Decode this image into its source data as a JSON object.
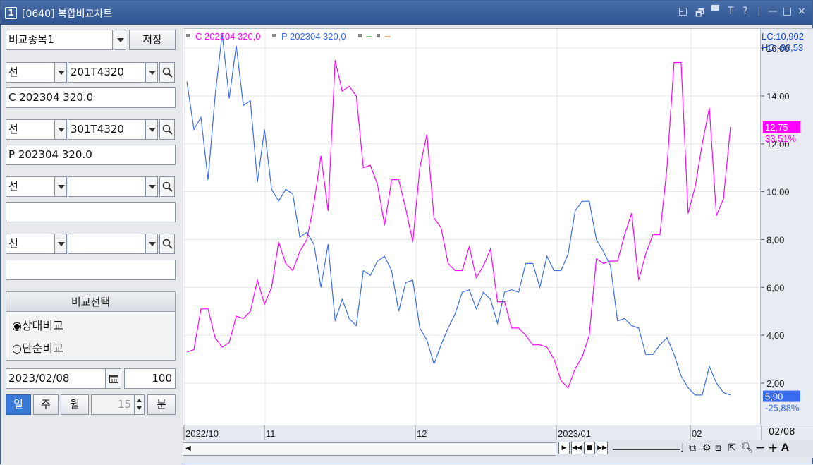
{
  "window": {
    "number": "1",
    "title": "[0640] 복합비교차트",
    "controls": [
      "◱",
      "🗗",
      "▀",
      "T",
      "?",
      "|",
      "—",
      "□",
      "×"
    ]
  },
  "panel": {
    "preset": "비교종목1",
    "save_label": "저장",
    "rows": [
      {
        "type": "선",
        "code": "201T4320",
        "name": "C 202304 320.0"
      },
      {
        "type": "선",
        "code": "301T4320",
        "name": "P 202304 320.0"
      },
      {
        "type": "선",
        "code": "",
        "name": ""
      },
      {
        "type": "선",
        "code": "",
        "name": ""
      }
    ],
    "compare_header": "비교선택",
    "relative": "◉상대비교",
    "simple": "○단순비교",
    "date": "2023/02/08",
    "count": "100",
    "periods": [
      "일",
      "주",
      "월"
    ],
    "minute_value": "15",
    "minute_label": "분"
  },
  "chart": {
    "legend": [
      {
        "label": "C 202304 320,0",
        "color": "#ff00ff"
      },
      {
        "label": "P 202304 320,0",
        "color": "#3a6cf0"
      }
    ],
    "legend_extra": [
      "−",
      "−"
    ],
    "top_right": [
      "LC:10,902",
      "HC:-88,53"
    ],
    "y_ticks": [
      "16,00",
      "14,00",
      "12,00",
      "10,00",
      "8,00",
      "6,00",
      "4,00",
      "2,00"
    ],
    "c_badge": {
      "value": "12,75",
      "pct": "33,51%",
      "color": "#ff00ff"
    },
    "p_badge": {
      "value": "5,90",
      "pct": "-25,88%",
      "color": "#3a6cf0"
    },
    "x_labels": [
      "2022/10",
      "11",
      "12",
      "2023/01",
      "02"
    ],
    "x_last": "02/08"
  },
  "chart_data": {
    "type": "line",
    "ylim": [
      0.2,
      16.8
    ],
    "series": [
      {
        "name": "C 202304 320,0",
        "color": "#ff00ff",
        "values": [
          3.3,
          3.4,
          5.1,
          5.1,
          3.9,
          3.5,
          3.7,
          4.8,
          4.7,
          5.0,
          6.3,
          5.3,
          6.0,
          7.9,
          7.0,
          6.7,
          7.5,
          8.0,
          9.5,
          11.5,
          9.2,
          15.5,
          14.2,
          14.4,
          14.0,
          11.0,
          11.1,
          10.3,
          8.6,
          10.5,
          10.5,
          9.3,
          7.9,
          11.0,
          12.4,
          8.9,
          8.5,
          7.0,
          6.7,
          6.7,
          7.7,
          6.4,
          6.9,
          7.6,
          5.4,
          5.4,
          4.3,
          4.3,
          4.0,
          3.6,
          3.6,
          3.5,
          3.0,
          2.1,
          1.8,
          2.6,
          3.1,
          4.0,
          7.2,
          7.0,
          7.1,
          7.1,
          8.2,
          9.1,
          6.3,
          7.4,
          8.2,
          8.2,
          11.0,
          15.4,
          15.4,
          9.1,
          10.2,
          12.0,
          13.5,
          9.0,
          9.7,
          12.7
        ]
      },
      {
        "name": "P 202304 320,0",
        "color": "#3a6cf0",
        "values": [
          14.6,
          12.6,
          13.1,
          10.5,
          14.0,
          16.6,
          13.9,
          16.1,
          13.6,
          13.8,
          10.4,
          12.6,
          10.1,
          9.6,
          10.1,
          9.9,
          8.1,
          8.3,
          7.8,
          6.0,
          7.8,
          4.6,
          5.5,
          4.7,
          4.4,
          6.7,
          6.5,
          7.1,
          7.3,
          6.7,
          5.0,
          6.2,
          6.3,
          4.3,
          3.8,
          2.8,
          3.6,
          4.3,
          4.9,
          5.8,
          5.9,
          5.1,
          5.8,
          5.5,
          4.5,
          5.8,
          5.9,
          5.8,
          7.0,
          7.0,
          6.0,
          7.3,
          6.7,
          6.7,
          7.4,
          9.2,
          9.6,
          9.6,
          8.0,
          7.5,
          6.9,
          4.6,
          4.7,
          4.4,
          4.3,
          3.2,
          3.2,
          3.6,
          3.9,
          3.2,
          2.3,
          1.8,
          1.5,
          1.5,
          2.7,
          2.0,
          1.6,
          1.5
        ]
      }
    ],
    "x_labels": [
      "2022/10",
      "11",
      "12",
      "2023/01",
      "02"
    ],
    "y_ticks": [
      16,
      14,
      12,
      10,
      8,
      6,
      4,
      2
    ]
  }
}
